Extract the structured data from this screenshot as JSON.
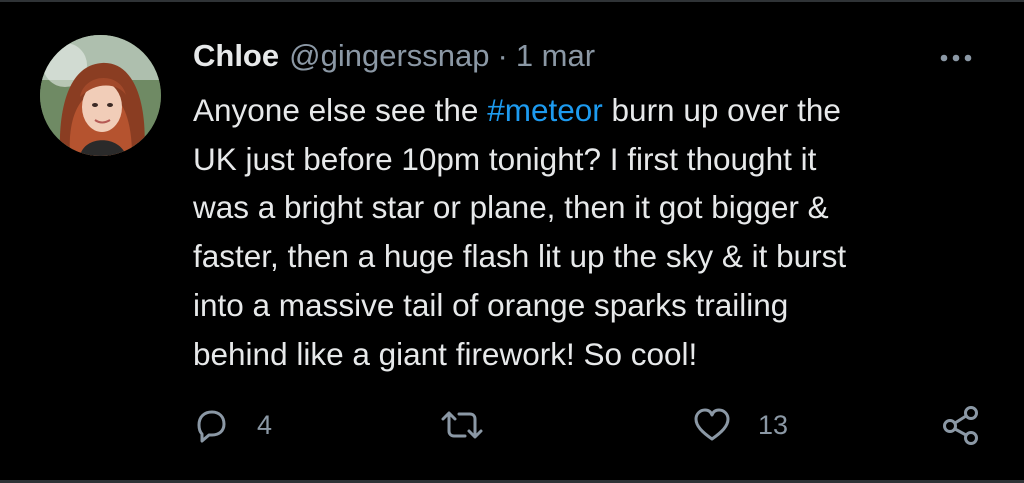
{
  "tweet": {
    "author_name": "Chloe",
    "handle": "@gingerssnap",
    "separator": "·",
    "timestamp": "1 mar",
    "text_lines": [
      {
        "before": "Anyone else see the ",
        "hashtag": "#meteor",
        "after": " burn up over the"
      },
      {
        "text": "UK just before 10pm tonight? I first thought it"
      },
      {
        "text": "was a bright star or plane, then it got bigger &"
      },
      {
        "text": "faster, then a huge flash lit up the sky & it burst"
      },
      {
        "text": "into a massive tail of orange sparks trailing"
      },
      {
        "text": "behind like a giant firework! So cool!"
      }
    ]
  },
  "actions": {
    "reply_icon": "reply-icon",
    "reply_count": "4",
    "retweet_icon": "retweet-icon",
    "like_icon": "heart-icon",
    "like_count": "13",
    "share_icon": "share-icon",
    "more_icon": "more-options-icon"
  },
  "colors": {
    "background": "#000000",
    "text": "#e7e9ea",
    "muted": "#8b98a5",
    "link": "#1d9bf0"
  }
}
